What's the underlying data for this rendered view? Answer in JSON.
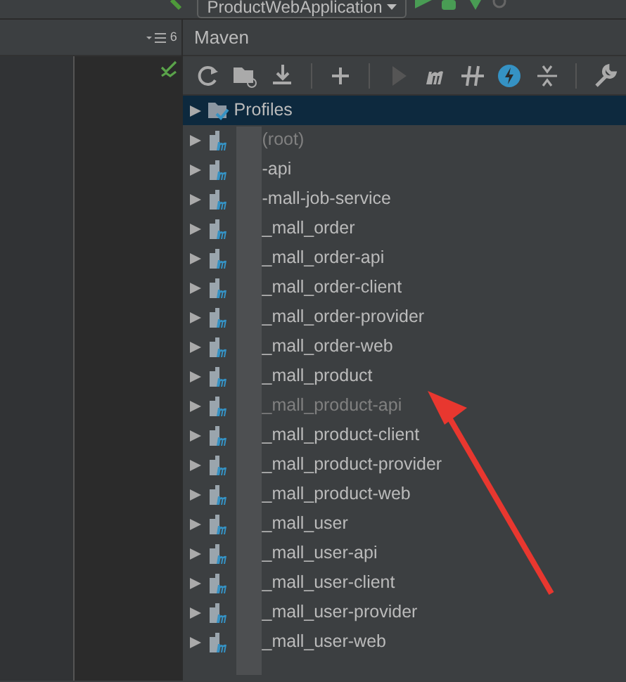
{
  "toolbar": {
    "run_config": "ProductWebApplication"
  },
  "editor": {
    "counter": "6"
  },
  "maven": {
    "title": "Maven",
    "items": [
      {
        "label": "Profiles",
        "kind": "profiles",
        "selected": true,
        "disabled": false
      },
      {
        "label": "(root)",
        "kind": "module",
        "selected": false,
        "disabled": true
      },
      {
        "label": "-api",
        "kind": "module",
        "selected": false,
        "disabled": false
      },
      {
        "label": "-mall-job-service",
        "kind": "module",
        "selected": false,
        "disabled": false
      },
      {
        "label": "_mall_order",
        "kind": "module",
        "selected": false,
        "disabled": false
      },
      {
        "label": "_mall_order-api",
        "kind": "module",
        "selected": false,
        "disabled": false
      },
      {
        "label": "_mall_order-client",
        "kind": "module",
        "selected": false,
        "disabled": false
      },
      {
        "label": "_mall_order-provider",
        "kind": "module",
        "selected": false,
        "disabled": false
      },
      {
        "label": "_mall_order-web",
        "kind": "module",
        "selected": false,
        "disabled": false
      },
      {
        "label": "_mall_product",
        "kind": "module",
        "selected": false,
        "disabled": false
      },
      {
        "label": "_mall_product-api",
        "kind": "module",
        "selected": false,
        "disabled": true
      },
      {
        "label": "_mall_product-client",
        "kind": "module",
        "selected": false,
        "disabled": false
      },
      {
        "label": "_mall_product-provider",
        "kind": "module",
        "selected": false,
        "disabled": false
      },
      {
        "label": "_mall_product-web",
        "kind": "module",
        "selected": false,
        "disabled": false
      },
      {
        "label": "_mall_user",
        "kind": "module",
        "selected": false,
        "disabled": false
      },
      {
        "label": "_mall_user-api",
        "kind": "module",
        "selected": false,
        "disabled": false
      },
      {
        "label": "_mall_user-client",
        "kind": "module",
        "selected": false,
        "disabled": false
      },
      {
        "label": "_mall_user-provider",
        "kind": "module",
        "selected": false,
        "disabled": false
      },
      {
        "label": "_mall_user-web",
        "kind": "module",
        "selected": false,
        "disabled": false
      }
    ]
  }
}
